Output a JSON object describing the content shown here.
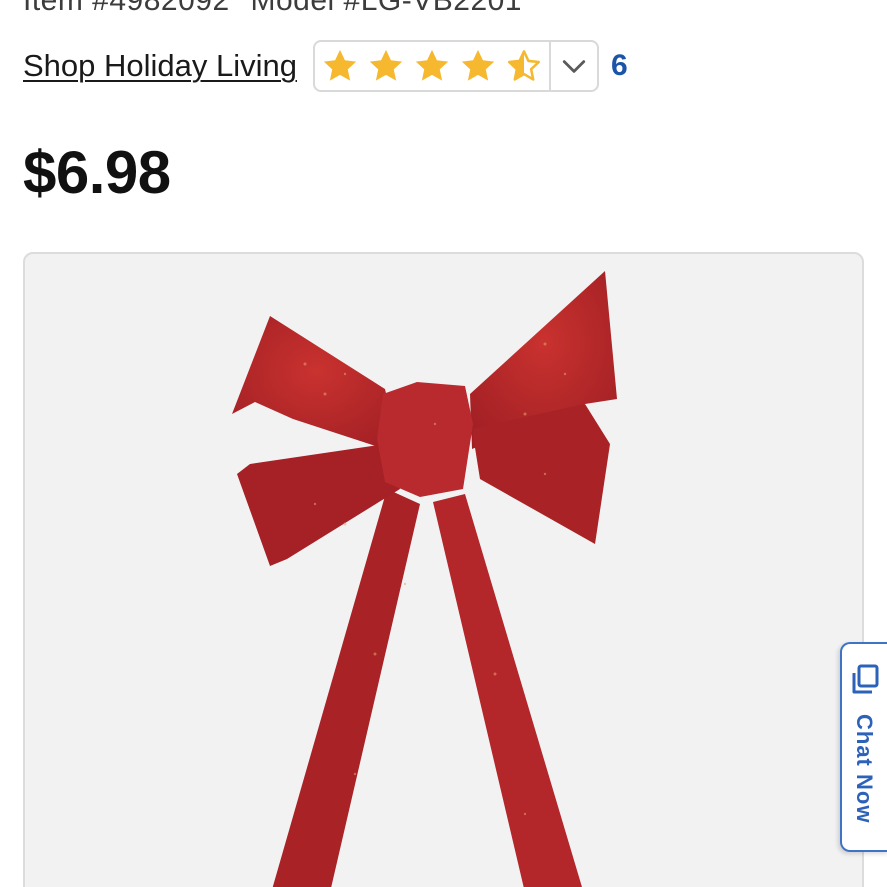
{
  "product": {
    "item_label": "Item #4982092",
    "model_label": "Model #LG-VB2201",
    "brand_link": "Shop Holiday Living",
    "rating": {
      "value": 4.5,
      "max": 5,
      "review_count": "6"
    },
    "price": "$6.98"
  },
  "chat": {
    "label": "Chat Now"
  },
  "colors": {
    "star": "#f5b82e",
    "link_blue": "#1c55a8",
    "chat_blue": "#2c62b8",
    "bow_red": "#b3262a"
  },
  "icons": {
    "rating_toggle": "chevron-down-icon",
    "chat": "chat-bubble-icon",
    "star": "star-icon"
  }
}
